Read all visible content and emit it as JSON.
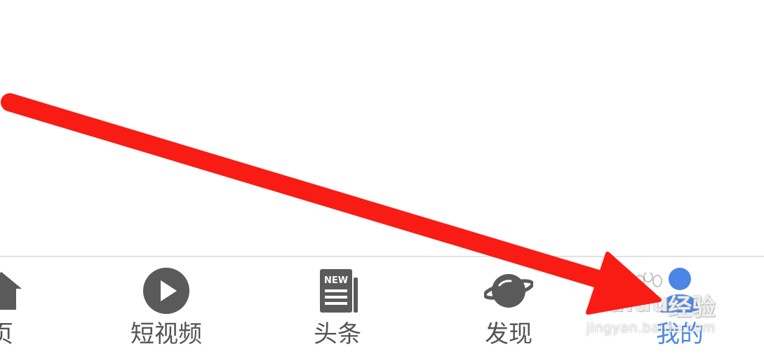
{
  "tabbar": {
    "tabs": [
      {
        "label": "页",
        "icon": "home-icon",
        "active": false
      },
      {
        "label": "短视频",
        "icon": "play-circle-icon",
        "active": false
      },
      {
        "label": "头条",
        "icon": "news-icon",
        "active": false,
        "icon_text": "NEW"
      },
      {
        "label": "发现",
        "icon": "planet-icon",
        "active": false
      },
      {
        "label": "我的",
        "icon": "user-icon",
        "active": true
      }
    ]
  },
  "watermark": {
    "brand": "Baidu",
    "brand_cn": "经验",
    "url": "jingyan.baidu.com"
  },
  "colors": {
    "icon_gray": "#5a5a5a",
    "label_gray": "#555555",
    "active_blue": "#4b86e6",
    "arrow_red": "#f81c14",
    "divider": "#e3e3e3"
  }
}
